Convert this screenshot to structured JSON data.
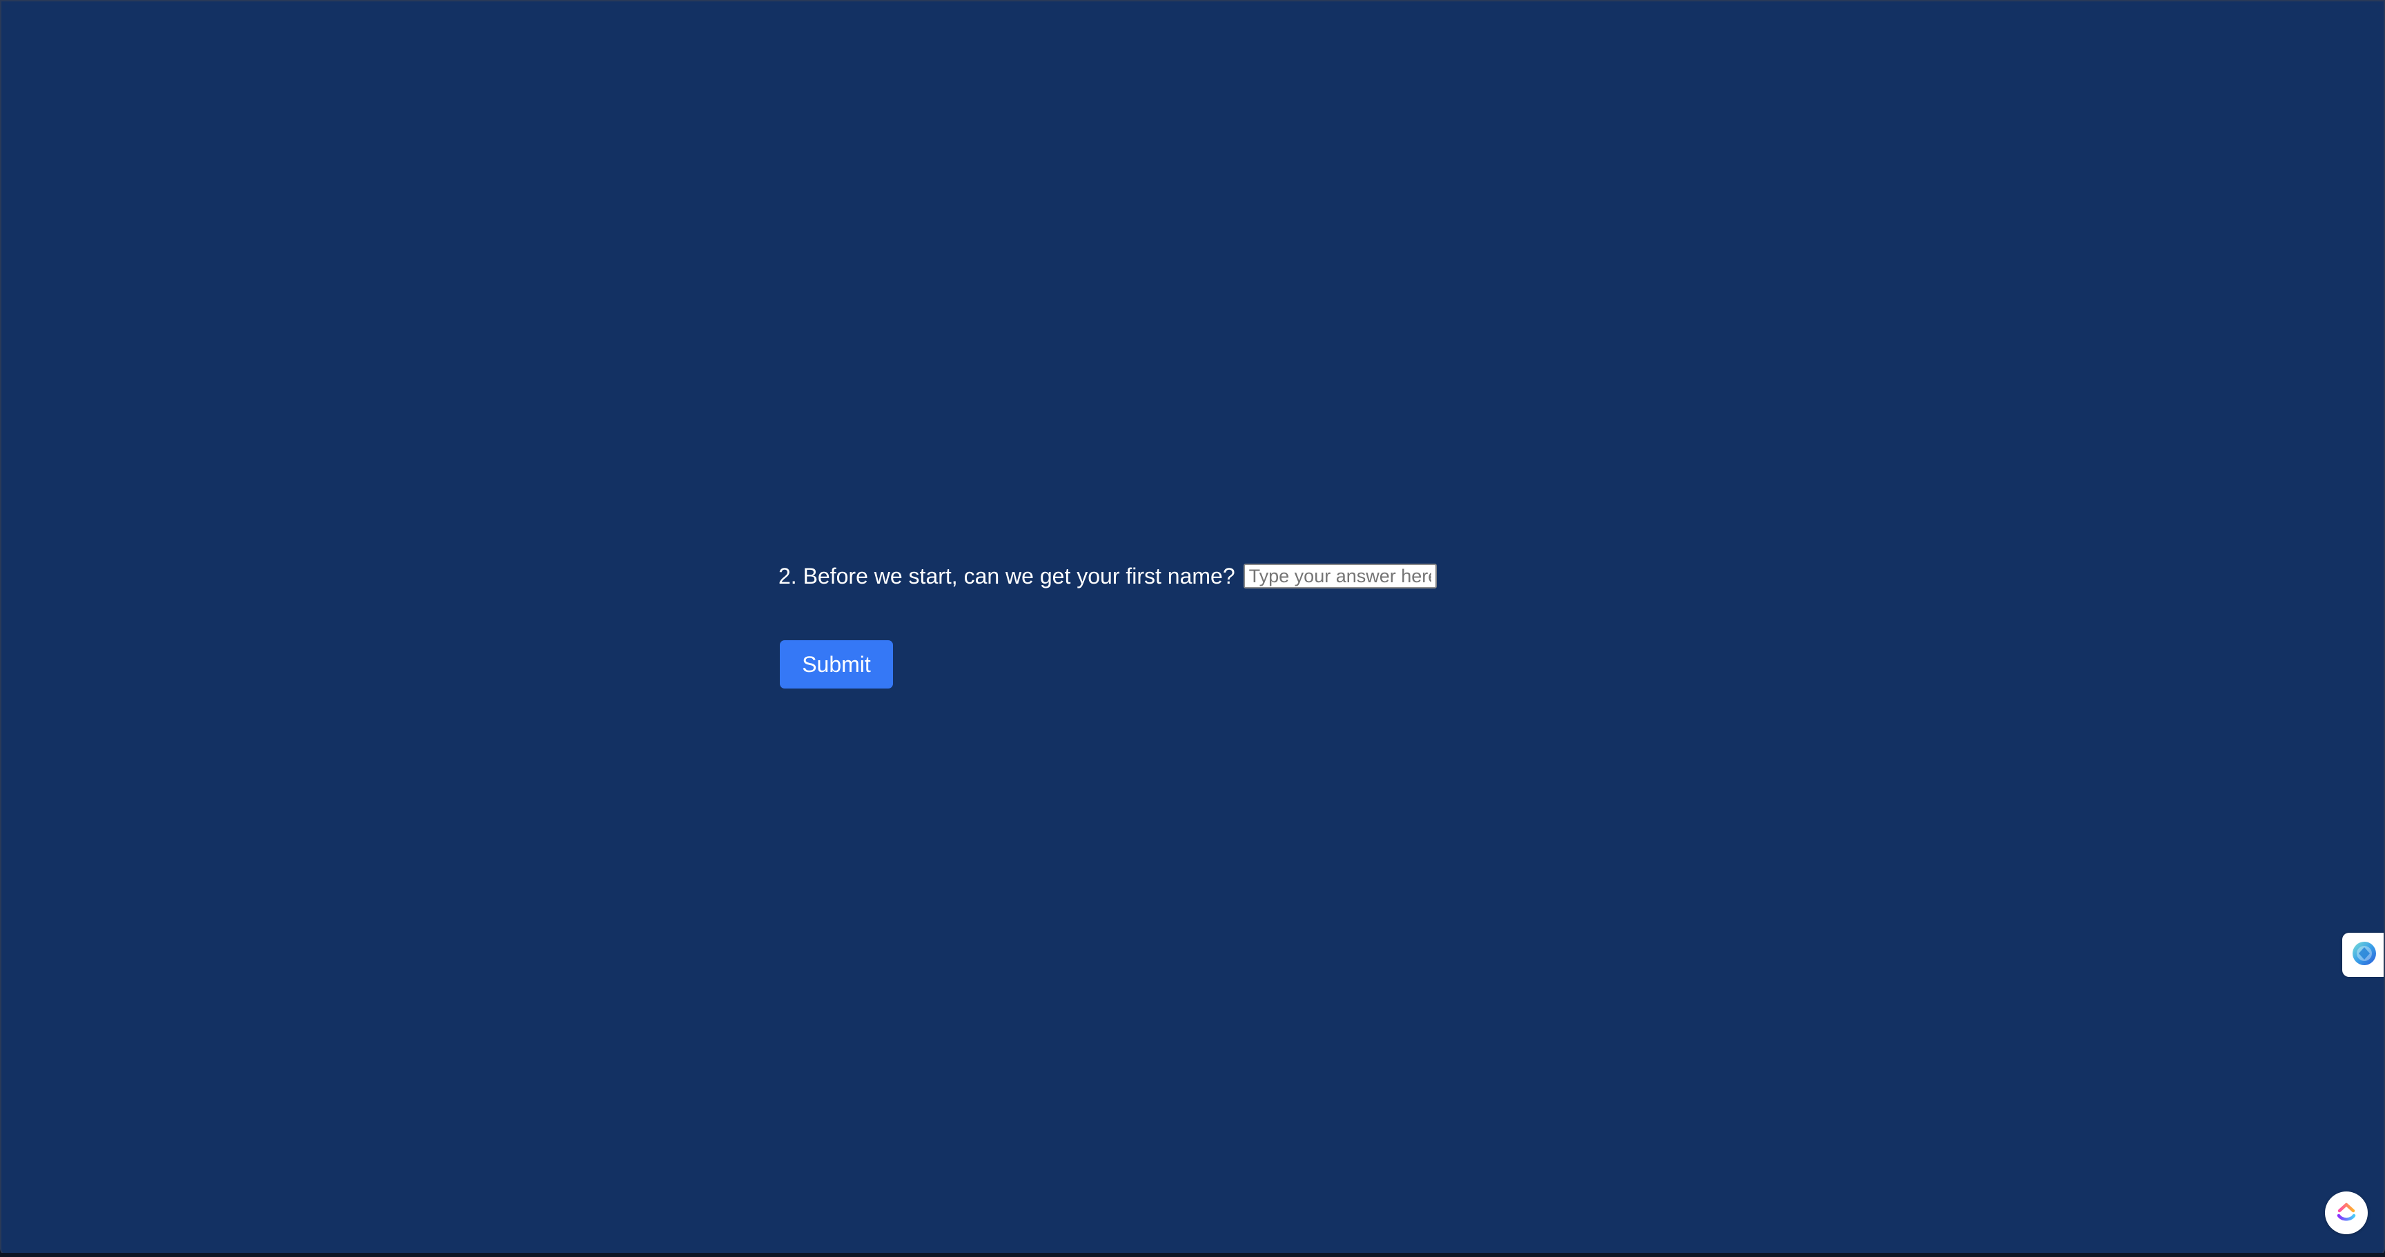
{
  "question": {
    "label": "2. Before we start, can we get your first name?",
    "answer_value": "",
    "answer_placeholder": "Type your answer here."
  },
  "actions": {
    "submit_label": "Submit"
  },
  "widgets": {
    "side_widget_icon": "assistant-orb-icon",
    "fab_icon": "clickup-logo-icon"
  },
  "colors": {
    "background": "#133163",
    "submit_button": "#3578f6",
    "text": "#ffffff"
  }
}
